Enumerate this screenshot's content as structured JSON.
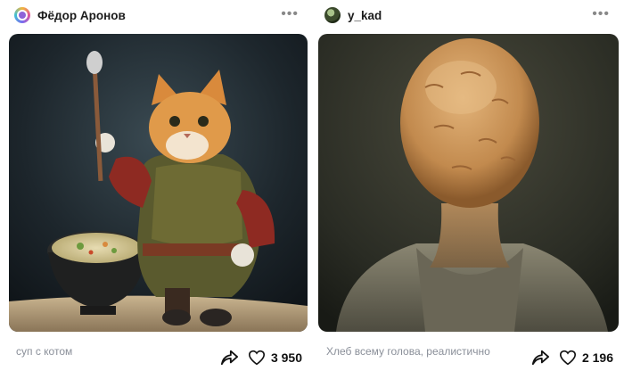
{
  "posts": [
    {
      "author": "Фёдор Аронов",
      "caption": "суп с котом",
      "likes": "3 950",
      "image_icon": "cat-cooking-soup-image",
      "more_icon": "more-dots-icon"
    },
    {
      "author": "y_kad",
      "caption": "Хлеб всему голова, реалистично",
      "likes": "2 196",
      "image_icon": "bread-head-image",
      "more_icon": "more-dots-icon"
    }
  ],
  "icons": {
    "share": "share-arrow-icon",
    "like": "heart-icon"
  },
  "colors": {
    "caption": "#8a8f99",
    "text": "#111111"
  }
}
